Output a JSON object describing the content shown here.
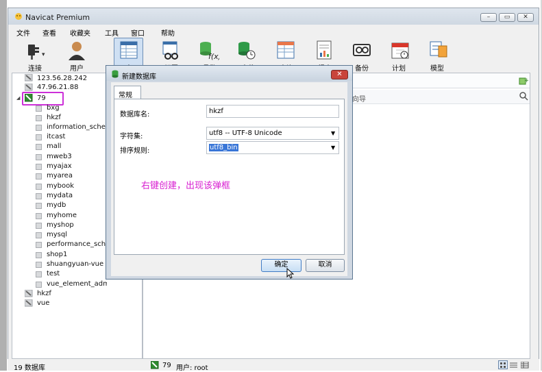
{
  "window": {
    "title": "Navicat Premium",
    "controls": [
      "–",
      "▭",
      "✕"
    ]
  },
  "menu": [
    "文件",
    "查看",
    "收藏夹",
    "工具",
    "窗口",
    "帮助"
  ],
  "toolbar": [
    {
      "label": "连接"
    },
    {
      "label": "用户"
    },
    {
      "label": "表"
    },
    {
      "label": "视图"
    },
    {
      "label": "函数"
    },
    {
      "label": "事件"
    },
    {
      "label": "查询"
    },
    {
      "label": "报表"
    },
    {
      "label": "备份"
    },
    {
      "label": "计划"
    },
    {
      "label": "模型"
    }
  ],
  "navigator": {
    "connections_top": [
      "123.56.28.242",
      "47.96.21.88"
    ],
    "active_connection": "79",
    "databases": [
      "bxg",
      "hkzf",
      "information_schem",
      "itcast",
      "mall",
      "mweb3",
      "myajax",
      "myarea",
      "mybook",
      "mydata",
      "mydb",
      "myhome",
      "myshop",
      "mysql",
      "performance_schen",
      "shop1",
      "shuangyuan-vue",
      "test",
      "vue_element_admin"
    ],
    "connections_bottom": [
      "hkzf",
      "vue"
    ]
  },
  "main": {
    "wizard_text": "向导"
  },
  "dialog": {
    "title": "新建数据库",
    "tab": "常规",
    "db_name_label": "数据库名:",
    "db_name_value": "hkzf",
    "charset_label": "字符集:",
    "charset_value": "utf8 -- UTF-8 Unicode",
    "collation_label": "排序规则:",
    "collation_value": "utf8_bin",
    "ok_label": "确定",
    "cancel_label": "取消"
  },
  "annotation": "右键创建，出现该弹框",
  "status": {
    "left": "19 数据库",
    "connection": "79",
    "user": "用户: root"
  },
  "colors": {
    "accent": "#3f7bc4",
    "annotation": "#d81fd1",
    "highlight": "#cc2fd8",
    "connection_green": "#2e8b2e"
  }
}
